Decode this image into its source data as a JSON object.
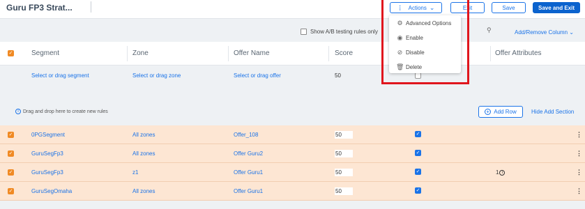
{
  "header": {
    "title": "Guru FP3 Strat...",
    "actions_label": "Actions",
    "exit_label": "Exit",
    "save_label": "Save",
    "save_exit_label": "Save and Exit"
  },
  "actions_menu": {
    "items": [
      {
        "label": "Advanced Options",
        "icon": "gear-icon"
      },
      {
        "label": "Enable",
        "icon": "eye-icon"
      },
      {
        "label": "Disable",
        "icon": "eye-slash-icon"
      },
      {
        "label": "Delete",
        "icon": "trash-icon"
      }
    ]
  },
  "toolbar": {
    "ab_label": "Show A/B testing rules only",
    "add_remove_label": "Add/Remove Column"
  },
  "columns": {
    "segment": "Segment",
    "zone": "Zone",
    "offer_name": "Offer Name",
    "score": "Score",
    "offer_attributes": "Offer Attributes"
  },
  "new_rule": {
    "segment_placeholder": "Select or drag segment",
    "zone_placeholder": "Select or drag zone",
    "offer_placeholder": "Select or drag offer",
    "score": "50"
  },
  "dropzone": {
    "hint": "Drag and drop here to create new rules",
    "add_row_label": "Add Row",
    "hide_add_label": "Hide Add Section"
  },
  "rows": [
    {
      "segment": "0PGSegment",
      "zone": "All zones",
      "offer": "Offer_108",
      "score": "50",
      "attr": ""
    },
    {
      "segment": "GuruSegFp3",
      "zone": "All zones",
      "offer": "Offer Guru2",
      "score": "50",
      "attr": ""
    },
    {
      "segment": "GuruSegFp3",
      "zone": "z1",
      "offer": "Offer Guru1",
      "score": "50",
      "attr": "1"
    },
    {
      "segment": "GuruSegOmaha",
      "zone": "All zones",
      "offer": "Offer Guru1",
      "score": "50",
      "attr": ""
    }
  ],
  "colors": {
    "accent": "#1a73e8",
    "row_highlight": "#fde6d3",
    "checkbox_orange": "#f08a24",
    "annotation_red": "#e0161d"
  }
}
